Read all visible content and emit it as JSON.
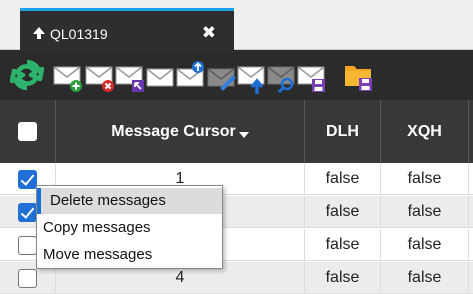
{
  "tab": {
    "title": "QL01319",
    "close_glyph": "✖",
    "icon": "arrow-up-icon"
  },
  "toolbar": {
    "buttons": [
      {
        "name": "refresh-button",
        "icon": "refresh-icon"
      },
      {
        "name": "add-message-button",
        "icon": "mail-add-icon"
      },
      {
        "name": "delete-message-button",
        "icon": "mail-delete-icon"
      },
      {
        "name": "move-cursor-button",
        "icon": "mail-cursor-icon"
      },
      {
        "name": "mail-button",
        "icon": "mail-icon"
      },
      {
        "name": "mail-upload-button",
        "icon": "mail-upload-icon"
      },
      {
        "name": "mail-edit-button",
        "icon": "mail-edit-icon"
      },
      {
        "name": "mail-send-button",
        "icon": "mail-send-icon"
      },
      {
        "name": "mail-search-button",
        "icon": "mail-search-icon"
      },
      {
        "name": "mail-save-button",
        "icon": "mail-save-icon"
      },
      {
        "name": "folder-save-button",
        "icon": "folder-save-icon"
      }
    ]
  },
  "grid": {
    "columns": [
      "Message Cursor",
      "DLH",
      "XQH"
    ],
    "rows": [
      {
        "checked": true,
        "cursor": "1",
        "dlh": "false",
        "xqh": "false"
      },
      {
        "checked": true,
        "cursor": "",
        "dlh": "false",
        "xqh": "false"
      },
      {
        "checked": false,
        "cursor": "",
        "dlh": "false",
        "xqh": "false"
      },
      {
        "checked": false,
        "cursor": "4",
        "dlh": "false",
        "xqh": "false"
      }
    ]
  },
  "context_menu": {
    "items": [
      "Delete messages",
      "Copy messages",
      "Move messages"
    ],
    "highlighted": 0
  },
  "colors": {
    "accent": "#1aa3e8",
    "checkbox": "#1f6fd6",
    "header_bg": "#383838",
    "toolbar_bg": "#2b2b2b",
    "refresh": "#2db36b",
    "save": "#7a3fb8",
    "folder": "#f2a623"
  }
}
